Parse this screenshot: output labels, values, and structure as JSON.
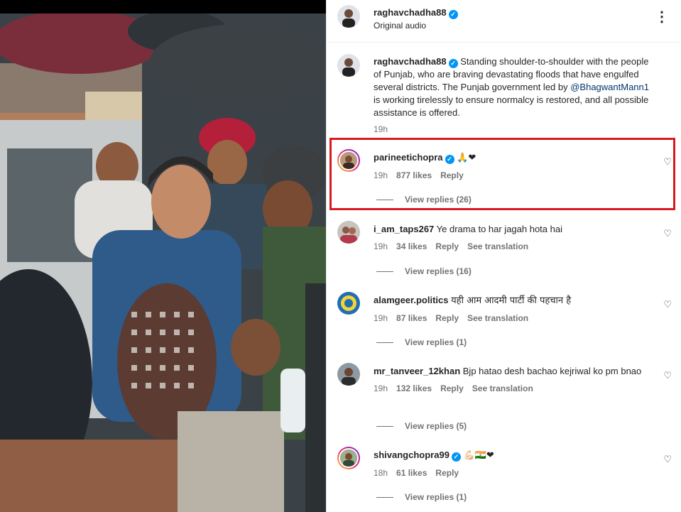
{
  "header": {
    "username": "raghavchadha88",
    "audio": "Original audio"
  },
  "caption": {
    "username": "raghavchadha88",
    "text_before": "Standing shoulder-to-shoulder with the people of Punjab, who are braving devastating floods that have engulfed several districts. The Punjab government led by ",
    "mention": "@BhagwantMann1",
    "text_after": " is working tirelessly to ensure normalcy is restored, and all possible assistance is offered.",
    "time": "19h"
  },
  "comments": [
    {
      "username": "parineetichopra",
      "verified": true,
      "text": "🙏❤",
      "time": "19h",
      "likes": "877 likes",
      "reply": "Reply",
      "view_replies": "View replies (26)"
    },
    {
      "username": "i_am_taps267",
      "text": "Ye drama to har jagah hota hai",
      "time": "19h",
      "likes": "34 likes",
      "reply": "Reply",
      "translate": "See translation",
      "view_replies": "View replies (16)"
    },
    {
      "username": "alamgeer.politics",
      "text": "यही आम आदमी पार्टी की पहचान है",
      "time": "19h",
      "likes": "87 likes",
      "reply": "Reply",
      "translate": "See translation",
      "view_replies": "View replies (1)"
    },
    {
      "username": "mr_tanveer_12khan",
      "text": "Bjp hatao desh bachao kejriwal ko pm bnao",
      "time": "19h",
      "likes": "132 likes",
      "reply": "Reply",
      "translate": "See translation",
      "view_replies": "View replies (5)"
    },
    {
      "username": "shivangchopra99",
      "verified": true,
      "text": "💪🏻🇮🇳❤",
      "time": "18h",
      "likes": "61 likes",
      "reply": "Reply",
      "view_replies": "View replies (1)"
    }
  ],
  "icons": {
    "more": "more-options-icon",
    "like": "heart-outline-icon",
    "verified": "verified-badge-icon"
  },
  "colors": {
    "accent": "#0095f6",
    "highlight": "#d71920",
    "muted": "#737373"
  }
}
